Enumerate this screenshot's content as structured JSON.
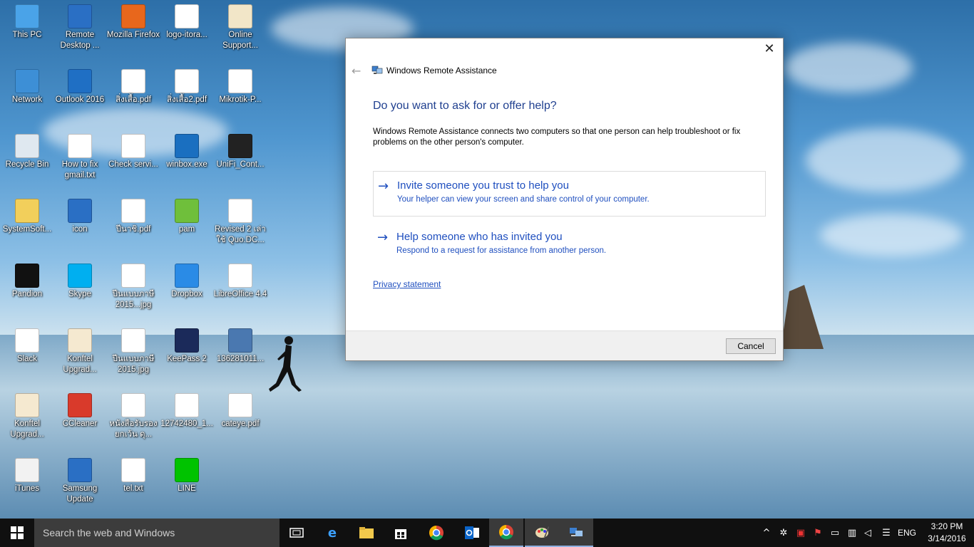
{
  "desktop": {
    "icons": [
      {
        "label": "This PC",
        "icon": "computer-icon",
        "color": "#4aa3e8"
      },
      {
        "label": "Remote Desktop ...",
        "icon": "remote-desktop-icon",
        "color": "#2a6fc4"
      },
      {
        "label": "Mozilla Firefox",
        "icon": "firefox-icon",
        "color": "#e8671c"
      },
      {
        "label": "logo-itora...",
        "icon": "image-file-icon",
        "color": "#ffffff"
      },
      {
        "label": "Online Support...",
        "icon": "clipboard-icon",
        "color": "#f2e6c8"
      },
      {
        "label": "Network",
        "icon": "network-icon",
        "color": "#3d8fd6"
      },
      {
        "label": "Outlook 2016",
        "icon": "outlook-icon",
        "color": "#1f6fc4"
      },
      {
        "label": "สิ่งเสื้อ.pdf",
        "icon": "pdf-file-icon",
        "color": "#ffffff"
      },
      {
        "label": "สิ่งเสื้อ2.pdf",
        "icon": "pdf-file-icon",
        "color": "#ffffff"
      },
      {
        "label": "Mikrotik-P...",
        "icon": "text-file-icon",
        "color": "#ffffff"
      },
      {
        "label": "Recycle Bin",
        "icon": "recycle-bin-icon",
        "color": "#dfe8f0"
      },
      {
        "label": "How to fix gmail.txt",
        "icon": "text-file-icon",
        "color": "#ffffff"
      },
      {
        "label": "Check servi...",
        "icon": "text-file-icon",
        "color": "#ffffff"
      },
      {
        "label": "winbox.exe",
        "icon": "winbox-icon",
        "color": "#1a6fc0"
      },
      {
        "label": "UniFi_Cont...",
        "icon": "unifi-icon",
        "color": "#222222"
      },
      {
        "label": "SystemSoft...",
        "icon": "folder-icon",
        "color": "#f2cf5b"
      },
      {
        "label": "icon",
        "icon": "folder-icon",
        "color": "#2a6fc4"
      },
      {
        "label": "ปีนาชิ.pdf",
        "icon": "pdf-file-icon",
        "color": "#ffffff"
      },
      {
        "label": "pam",
        "icon": "folder-icon",
        "color": "#6fbf3b"
      },
      {
        "label": "Revised 2 เล่าใช้ Quo.DC...",
        "icon": "document-icon",
        "color": "#ffffff"
      },
      {
        "label": "Pandion",
        "icon": "pandion-icon",
        "color": "#111111"
      },
      {
        "label": "Skype",
        "icon": "skype-icon",
        "color": "#00aff0"
      },
      {
        "label": "ปีนแบบภาษี 2015...jpg",
        "icon": "image-file-icon",
        "color": "#ffffff"
      },
      {
        "label": "Dropbox",
        "icon": "dropbox-icon",
        "color": "#2a8be6"
      },
      {
        "label": "LibreOffice 4.4",
        "icon": "libreoffice-icon",
        "color": "#ffffff"
      },
      {
        "label": "Slack",
        "icon": "slack-icon",
        "color": "#ffffff"
      },
      {
        "label": "Konftel Upgrad...",
        "icon": "konftel-icon",
        "color": "#f5e9d0"
      },
      {
        "label": "ปีนแบบภาษี 2015.jpg",
        "icon": "image-file-icon",
        "color": "#ffffff"
      },
      {
        "label": "KeePass 2",
        "icon": "keepass-icon",
        "color": "#1b2a5a"
      },
      {
        "label": "136281011...",
        "icon": "image-file-icon",
        "color": "#4a78b0"
      },
      {
        "label": "Konftel Upgrad...",
        "icon": "konftel-icon",
        "color": "#f5e9d0"
      },
      {
        "label": "CCleaner",
        "icon": "ccleaner-icon",
        "color": "#d93a2b"
      },
      {
        "label": "หนังสือรับรองยกเว้น ดุ...",
        "icon": "document-icon",
        "color": "#ffffff"
      },
      {
        "label": "12742480_1...",
        "icon": "image-file-icon",
        "color": "#ffffff"
      },
      {
        "label": "cateye.pdf",
        "icon": "pdf-file-icon",
        "color": "#ffffff"
      },
      {
        "label": "iTunes",
        "icon": "itunes-icon",
        "color": "#f2f2f2"
      },
      {
        "label": "Samsung Update",
        "icon": "samsung-update-icon",
        "color": "#2a6fc4"
      },
      {
        "label": "tel.txt",
        "icon": "text-file-icon",
        "color": "#ffffff"
      },
      {
        "label": "LINE",
        "icon": "line-icon",
        "color": "#00c300"
      }
    ]
  },
  "dialog": {
    "title": "Windows Remote Assistance",
    "heading": "Do you want to ask for or offer help?",
    "description": "Windows Remote Assistance connects two computers so that one person can help troubleshoot or fix problems on the other person's computer.",
    "options": [
      {
        "title": "Invite someone you trust to help you",
        "subtitle": "Your helper can view your screen and share control of your computer."
      },
      {
        "title": "Help someone who has invited you",
        "subtitle": "Respond to a request for assistance from another person."
      }
    ],
    "privacy_link": "Privacy statement",
    "cancel_label": "Cancel",
    "close_glyph": "✕",
    "back_glyph": "←",
    "accent_color": "#1f4fbf"
  },
  "taskbar": {
    "search_placeholder": "Search the web and Windows",
    "apps": [
      "task-view-icon",
      "edge-icon",
      "file-explorer-icon",
      "store-icon",
      "chrome-icon",
      "outlook-icon",
      "chrome-icon",
      "paint-icon",
      "remote-assistance-icon"
    ],
    "tray": {
      "language": "ENG",
      "time": "3:20 PM",
      "date": "3/14/2016"
    }
  }
}
